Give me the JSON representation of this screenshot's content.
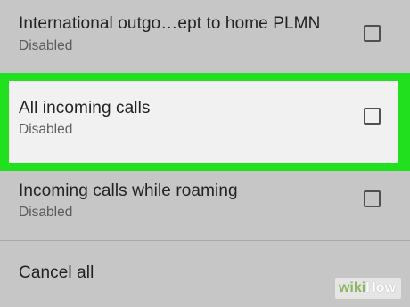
{
  "list": {
    "items": [
      {
        "title": "International outgo…ept to home PLMN",
        "summary": "Disabled",
        "checked": false
      },
      {
        "title": "All incoming calls",
        "summary": "Disabled",
        "checked": false,
        "highlighted": true
      },
      {
        "title": "Incoming calls while roaming",
        "summary": "Disabled",
        "checked": false
      }
    ],
    "cancel_all": "Cancel all"
  },
  "colors": {
    "highlight_border": "#21e01d",
    "highlight_fill": "#f1f1f1",
    "background": "#c6c6c6"
  },
  "watermark": {
    "part1": "wiki",
    "part2": "How"
  }
}
